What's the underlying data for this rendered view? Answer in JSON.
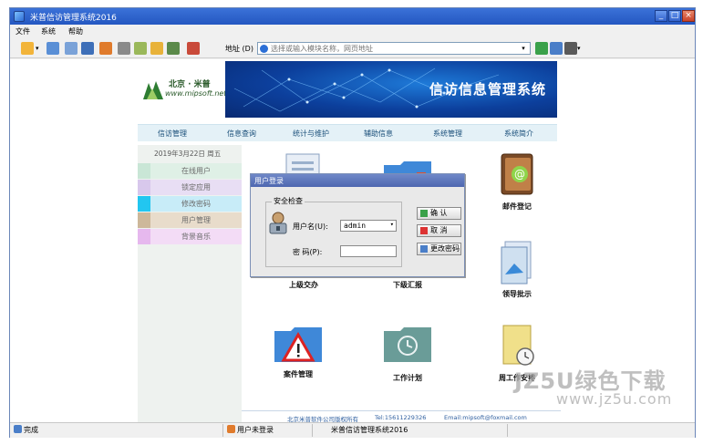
{
  "window": {
    "title": "米普信访管理系统2016"
  },
  "menu": {
    "items": [
      "文件",
      "系统",
      "帮助"
    ]
  },
  "toolbar": {
    "icons": [
      "new-icon",
      "dropdown-icon",
      "list-icon",
      "grid-icon",
      "folder-icon",
      "home-icon",
      "print-icon",
      "refresh-icon",
      "lock-icon",
      "users-icon",
      "exit-icon"
    ],
    "address_label": "地址 (D)",
    "address_placeholder": "选择或输入模块名称，网页地址"
  },
  "banner": {
    "logo_line1": "北京 · 米普",
    "logo_line2": "www.mipsoft.net",
    "title": "信访信息管理系统"
  },
  "nav": {
    "items": [
      "信访管理",
      "信息查询",
      "统计与维护",
      "辅助信息",
      "系统管理",
      "系统简介"
    ]
  },
  "sidebar": {
    "date": "2019年3月22日  周五",
    "items": [
      {
        "label": "在线用户",
        "color": "#c9e6d6"
      },
      {
        "label": "锁定应用",
        "color": "#d8c8ec"
      },
      {
        "label": "修改密码",
        "color": "#22c6f0"
      },
      {
        "label": "用户管理",
        "color": "#cdb89a"
      },
      {
        "label": "背景音乐",
        "color": "#e6b8ee"
      }
    ]
  },
  "modules": [
    {
      "label": "邮件登记",
      "icon": "mail-book-icon"
    },
    {
      "label": "上级交办",
      "icon": "upload-doc-icon"
    },
    {
      "label": "下级汇报",
      "icon": "report-folder-icon"
    },
    {
      "label": "领导批示",
      "icon": "leader-doc-icon"
    },
    {
      "label": "案件管理",
      "icon": "warning-folder-icon"
    },
    {
      "label": "工作计划",
      "icon": "plan-folder-icon"
    },
    {
      "label": "周工作安排",
      "icon": "weekly-schedule-icon"
    }
  ],
  "footer": {
    "company": "北京米普软件公司版权所有",
    "tel": "Tel:15611229326",
    "email": "Email:mipsoft@foxmail.com"
  },
  "login_dialog": {
    "title": "用户登录",
    "group_label": "安全检查",
    "username_label": "用户名(U):",
    "username_value": "admin",
    "password_label": "密  码(P):",
    "password_value": "",
    "ok_label": "确 认",
    "cancel_label": "取 消",
    "change_pwd_label": "更改密码"
  },
  "status": {
    "ready": "完成",
    "user": "用户未登录",
    "app": "米普信访管理系统2016"
  },
  "watermark": {
    "line1": "JZ5U绿色下载",
    "line2": "www.jz5u.com"
  }
}
